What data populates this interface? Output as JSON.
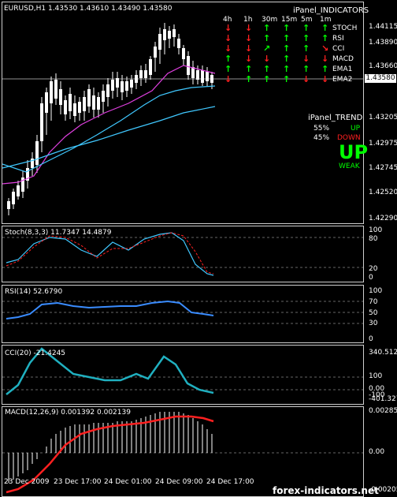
{
  "main": {
    "title": "EURUSD,H1  1.43530 1.43610 1.43490 1.43580",
    "yticks": [
      "1.44115",
      "1.43890",
      "1.43660",
      "1.43580",
      "1.43205",
      "1.42975",
      "1.42745",
      "1.42520",
      "1.42290"
    ],
    "price_box": "1.43580",
    "panel_title": "iPanel_INDICATORS",
    "timeframes": [
      "4h",
      "1h",
      "30m",
      "15m",
      "5m",
      "1m"
    ],
    "indicators": [
      "STOCH",
      "RSI",
      "CCI",
      "MACD",
      "EMA1",
      "EMA2"
    ],
    "arrows": [
      [
        "down",
        "down",
        "up",
        "up",
        "up",
        "up"
      ],
      [
        "down",
        "down",
        "up",
        "up",
        "up",
        "up"
      ],
      [
        "down",
        "down",
        "up-right",
        "up",
        "up",
        "down-right"
      ],
      [
        "up",
        "down",
        "down",
        "up",
        "down",
        "down"
      ],
      [
        "up",
        "up",
        "up",
        "up",
        "up",
        "up"
      ],
      [
        "down",
        "up",
        "up",
        "up",
        "down",
        "down"
      ]
    ],
    "trend_title": "iPanel_TREND",
    "trend_up_pct": "55%",
    "trend_up_label": "UP",
    "trend_down_pct": "45%",
    "trend_down_label": "DOWN",
    "trend_big": "UP",
    "trend_strength": "WEAK",
    "colors": {
      "up": "#00ff00",
      "down": "#ff2020"
    }
  },
  "stoch": {
    "title": "Stoch(8,3,3) 11.7347 14.4879",
    "yticks": [
      "100",
      "80",
      "20",
      "0"
    ]
  },
  "rsi": {
    "title": "RSI(14) 52.6790",
    "yticks": [
      "100",
      "70",
      "50",
      "30",
      "0"
    ]
  },
  "cci": {
    "title": "CCI(20) -21.4245",
    "yticks": [
      "340.5122",
      "100",
      "0.00",
      "-100",
      "-401.3277"
    ]
  },
  "macd": {
    "title": "MACD(12,26,9) 0.001392 0.002139",
    "yticks": [
      "0.002859",
      "0.00",
      "-0.00205"
    ]
  },
  "xaxis": [
    "23 Dec 2009",
    "23 Dec 17:00",
    "24 Dec 01:00",
    "24 Dec 09:00",
    "24 Dec 17:00"
  ],
  "watermark": "forex-indicators.net"
}
